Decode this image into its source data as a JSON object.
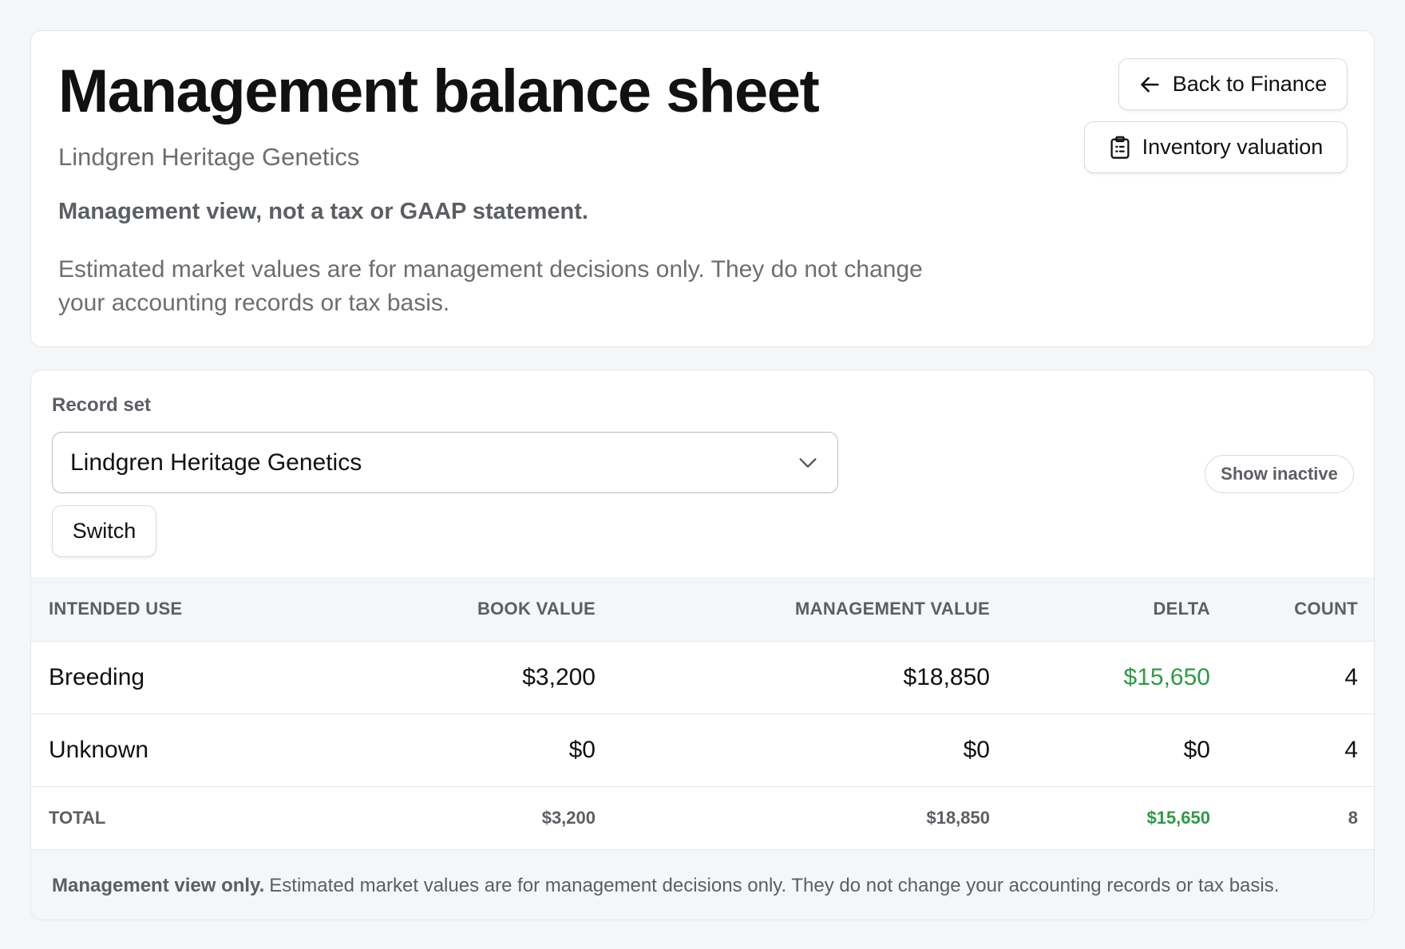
{
  "header": {
    "title": "Management balance sheet",
    "org_name": "Lindgren Heritage Genetics",
    "notice_bold": "Management view, not a tax or GAAP statement.",
    "notice_text": "Estimated market values are for management decisions only. They do not change your accounting records or tax basis.",
    "back_button": {
      "label": "Back to Finance",
      "icon": "arrow-left-icon"
    },
    "inventory_button": {
      "label": "Inventory valuation",
      "icon": "clipboard-icon"
    }
  },
  "record_set": {
    "label": "Record set",
    "selected": "Lindgren Heritage Genetics",
    "switch_label": "Switch",
    "show_inactive_label": "Show inactive"
  },
  "table": {
    "columns": [
      "Intended use",
      "Book value",
      "Management value",
      "Delta",
      "Count"
    ],
    "rows": [
      {
        "use": "Breeding",
        "book": "$3,200",
        "mgmt": "$18,850",
        "delta": "$15,650",
        "count": "4"
      },
      {
        "use": "Unknown",
        "book": "$0",
        "mgmt": "$0",
        "delta": "$0",
        "count": "4"
      }
    ],
    "total": {
      "label": "TOTAL",
      "book": "$3,200",
      "mgmt": "$18,850",
      "delta": "$15,650",
      "count": "8"
    }
  },
  "footer": {
    "bold": "Management view only.",
    "text": "Estimated market values are for management decisions only. They do not change your accounting records or tax basis."
  },
  "colors": {
    "positive": "#2e9a45",
    "muted_text": "#5b5e63",
    "border": "#e4e6ea",
    "background": "#f5f6f8"
  }
}
